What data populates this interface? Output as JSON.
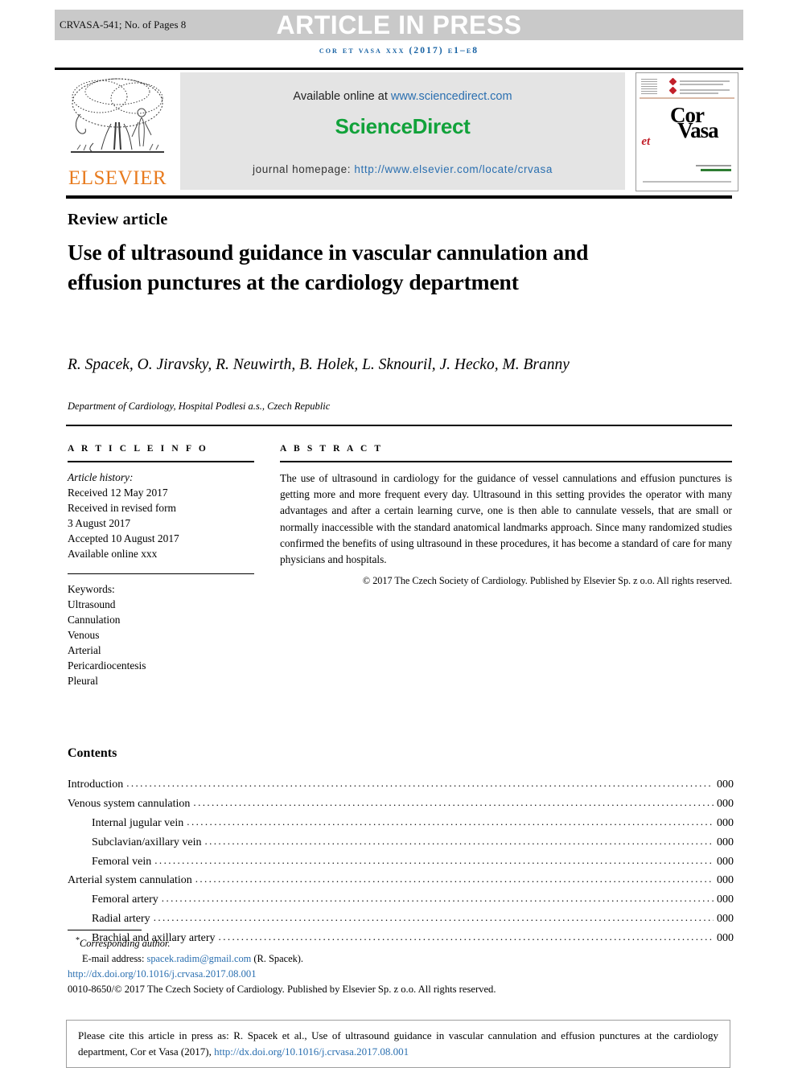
{
  "running_head": {
    "article_id": "CRVASA-541; No. of Pages 8",
    "press_status": "ARTICLE IN PRESS",
    "journal_ref": "cor et vasa xxx (2017) e1–e8"
  },
  "masthead": {
    "publisher_name": "ELSEVIER",
    "available_prefix": "Available online at ",
    "available_url": "www.sciencedirect.com",
    "platform": "ScienceDirect",
    "homepage_prefix": "journal homepage: ",
    "homepage_url": "http://www.elsevier.com/locate/crvasa",
    "cover": {
      "line1": "Cor",
      "line2": "et",
      "line3": "Vasa"
    }
  },
  "article": {
    "kind": "Review article",
    "title": "Use of ultrasound guidance in vascular cannulation and effusion punctures at the cardiology department",
    "authors": "R. Spacek, O. Jiravsky, R. Neuwirth, B. Holek, L. Sknouril, J. Hecko, M. Branny",
    "corresponding_marker": "*",
    "affiliation": "Department of Cardiology, Hospital Podlesi a.s., Czech Republic"
  },
  "info": {
    "heading": "A R T I C L E   I N F O",
    "history_label": "Article history:",
    "history": [
      "Received 12 May 2017",
      "Received in revised form",
      "3 August 2017",
      "Accepted 10 August 2017",
      "Available online xxx"
    ],
    "keywords_label": "Keywords:",
    "keywords": [
      "Ultrasound",
      "Cannulation",
      "Venous",
      "Arterial",
      "Pericardiocentesis",
      "Pleural"
    ]
  },
  "abstract": {
    "heading": "A B S T R A C T",
    "text": "The use of ultrasound in cardiology for the guidance of vessel cannulations and effusion punctures is getting more and more frequent every day. Ultrasound in this setting provides the operator with many advantages and after a certain learning curve, one is then able to cannulate vessels, that are small or normally inaccessible with the standard anatomical landmarks approach. Since many randomized studies confirmed the benefits of using ultrasound in these procedures, it has become a standard of care for many physicians and hospitals.",
    "copyright": "© 2017 The Czech Society of Cardiology. Published by Elsevier Sp. z o.o. All rights reserved."
  },
  "contents": {
    "heading": "Contents",
    "items": [
      {
        "label": "Introduction",
        "page": "000",
        "indent": false
      },
      {
        "label": "Venous system cannulation",
        "page": "000",
        "indent": false
      },
      {
        "label": "Internal jugular vein",
        "page": "000",
        "indent": true
      },
      {
        "label": "Subclavian/axillary vein",
        "page": "000",
        "indent": true
      },
      {
        "label": "Femoral vein",
        "page": "000",
        "indent": true
      },
      {
        "label": "Arterial system cannulation",
        "page": "000",
        "indent": false
      },
      {
        "label": "Femoral artery",
        "page": "000",
        "indent": true
      },
      {
        "label": "Radial artery",
        "page": "000",
        "indent": true
      },
      {
        "label": "Brachial and axillary artery",
        "page": "000",
        "indent": true
      }
    ]
  },
  "footnote": {
    "corresponding_author": "Corresponding author.",
    "email_label": "E-mail address: ",
    "email": "spacek.radim@gmail.com",
    "email_suffix": " (R. Spacek).",
    "doi": "http://dx.doi.org/10.1016/j.crvasa.2017.08.001",
    "issn_line": "0010-8650/© 2017 The Czech Society of Cardiology. Published by Elsevier Sp. z o.o. All rights reserved."
  },
  "cite_box": {
    "text": "Please cite this article in press as: R. Spacek et al., Use of ultrasound guidance in vascular cannulation and effusion punctures at the cardiology department, Cor et Vasa (2017), ",
    "doi": "http://dx.doi.org/10.1016/j.crvasa.2017.08.001"
  },
  "colors": {
    "link": "#2a6fb0",
    "journal_ref": "#1661a3",
    "sciencedirect_green": "#11a23a",
    "elsevier_orange": "#e87b1e",
    "band_gray": "#c9c9c9",
    "panel_gray": "#e4e4e4",
    "heart_red": "#c2202a"
  }
}
